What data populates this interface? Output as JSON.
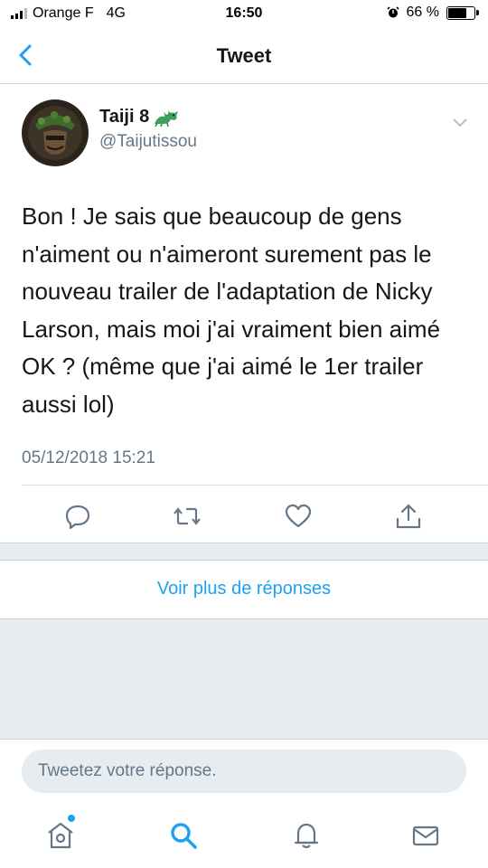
{
  "status_bar": {
    "carrier": "Orange F",
    "network": "4G",
    "time": "16:50",
    "battery_label": "66 %",
    "battery_level": 0.66
  },
  "nav": {
    "title": "Tweet"
  },
  "tweet": {
    "author_name": "Taiji 8",
    "author_handle": "@Taijutissou",
    "text": "Bon ! Je sais que beaucoup de gens n'aiment ou n'aimeront surement pas le nouveau trailer de l'adaptation de Nicky Larson, mais moi j'ai vraiment bien aimé OK ? (même que j'ai aimé le 1er trailer aussi lol)",
    "timestamp": "05/12/2018 15:21"
  },
  "more_replies": "Voir plus de réponses",
  "reply": {
    "placeholder": "Tweetez votre réponse."
  },
  "colors": {
    "accent": "#1da1f2",
    "muted": "#657786",
    "background_grey": "#e6ecf0"
  },
  "icons": [
    "back-chevron",
    "dragon-emoji",
    "caret-down",
    "reply",
    "retweet",
    "like",
    "share",
    "home",
    "search",
    "notifications",
    "messages"
  ]
}
